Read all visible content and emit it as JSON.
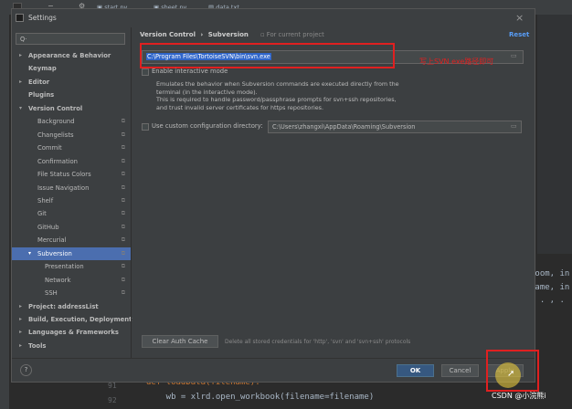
{
  "tabs": [
    "start.py",
    "sheet.py",
    "data.txt"
  ],
  "dialog": {
    "title": "Settings",
    "search_placeholder": "Q·",
    "sidebar": [
      {
        "label": "Appearance & Behavior",
        "bold": true,
        "arrow": "▸"
      },
      {
        "label": "Keymap",
        "bold": true
      },
      {
        "label": "Editor",
        "bold": true,
        "arrow": "▸"
      },
      {
        "label": "Plugins",
        "bold": true
      },
      {
        "label": "Version Control",
        "bold": true,
        "arrow": "▾"
      },
      {
        "label": "Background"
      },
      {
        "label": "Changelists"
      },
      {
        "label": "Commit"
      },
      {
        "label": "Confirmation"
      },
      {
        "label": "File Status Colors"
      },
      {
        "label": "Issue Navigation"
      },
      {
        "label": "Shelf"
      },
      {
        "label": "Git"
      },
      {
        "label": "GitHub"
      },
      {
        "label": "Mercurial"
      },
      {
        "label": "Subversion",
        "arrow": "▾",
        "selected": true
      },
      {
        "label": "Presentation"
      },
      {
        "label": "Network"
      },
      {
        "label": "SSH"
      },
      {
        "label": "Project: addressList",
        "bold": true,
        "arrow": "▸"
      },
      {
        "label": "Build, Execution, Deployment",
        "bold": true,
        "arrow": "▸"
      },
      {
        "label": "Languages & Frameworks",
        "bold": true,
        "arrow": "▸"
      },
      {
        "label": "Tools",
        "bold": true,
        "arrow": "▸"
      }
    ],
    "breadcrumb": {
      "part1": "Version Control",
      "sep": "›",
      "part2": "Subversion",
      "scope": "For current project"
    },
    "reset_label": "Reset",
    "svn_path": "C:\\Program Files\\TortoiseSVN\\bin\\svn.exe",
    "annotation": "写上SVN.exe路径即可",
    "interactive_label": "Enable interactive mode",
    "description": [
      "Emulates the behavior when Subversion commands are executed directly from the",
      "terminal (in the interactive mode).",
      "This is required to handle password/passphrase prompts for svn+ssh repositories,",
      "and trust invalid server certificates for https repositories."
    ],
    "config_label": "Use custom configuration directory:",
    "config_path": "C:\\Users\\zhangxi\\AppData\\Roaming\\Subversion",
    "clear_cache_label": "Clear Auth Cache",
    "clear_cache_desc": "Delete all stored credentials for 'http', 'svn' and 'svn+ssh' protocols",
    "help_label": "?",
    "ok_label": "OK",
    "cancel_label": "Cancel",
    "apply_label": "Apply",
    "close_label": "×"
  },
  "editor": {
    "right_snippets": [
      "room, in",
      "name, in",
      ", . , ."
    ],
    "lines": [
      {
        "no": "91",
        "code": "def loadData(filename):"
      },
      {
        "no": "92",
        "code": "    wb = xlrd.open_workbook(filename=filename)"
      }
    ]
  },
  "watermark": "CSDN @小浣熊i",
  "colors": {
    "accent": "#4b6eaf",
    "annotation": "#e02020",
    "link": "#589df6"
  }
}
